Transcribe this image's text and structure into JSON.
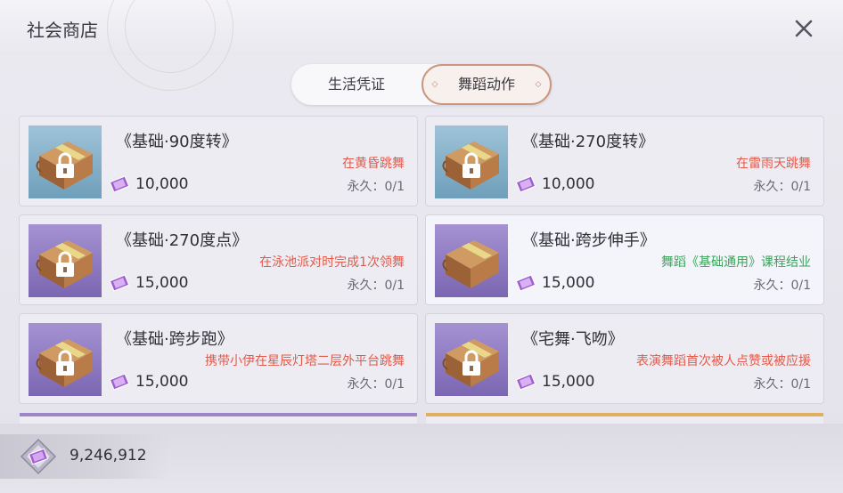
{
  "window": {
    "title": "社会商店"
  },
  "tabs": [
    {
      "label": "生活凭证",
      "selected": false
    },
    {
      "label": "舞蹈动作",
      "selected": true
    }
  ],
  "items": [
    {
      "name": "《基础·90度转》",
      "requirement": "在黄昏跳舞",
      "requirement_color": "red",
      "price": "10,000",
      "limit": "永久：0/1",
      "locked": true,
      "thumb_bg": "blue"
    },
    {
      "name": "《基础·270度转》",
      "requirement": "在雷雨天跳舞",
      "requirement_color": "red",
      "price": "10,000",
      "limit": "永久：0/1",
      "locked": true,
      "thumb_bg": "blue"
    },
    {
      "name": "《基础·270度点》",
      "requirement": "在泳池派对时完成1次领舞",
      "requirement_color": "red",
      "price": "15,000",
      "limit": "永久：0/1",
      "locked": true,
      "thumb_bg": "purple"
    },
    {
      "name": "《基础·跨步伸手》",
      "requirement": "舞蹈《基础通用》课程结业",
      "requirement_color": "green",
      "price": "15,000",
      "limit": "永久：0/1",
      "locked": false,
      "thumb_bg": "purple"
    },
    {
      "name": "《基础·跨步跑》",
      "requirement": "携带小伊在星辰灯塔二层外平台跳舞",
      "requirement_color": "red",
      "price": "15,000",
      "limit": "永久：0/1",
      "locked": true,
      "thumb_bg": "purple"
    },
    {
      "name": "《宅舞·飞吻》",
      "requirement": "表演舞蹈首次被人点赞或被应援",
      "requirement_color": "red",
      "price": "15,000",
      "limit": "永久：0/1",
      "locked": true,
      "thumb_bg": "purple"
    }
  ],
  "currency": {
    "amount": "9,246,912"
  },
  "colors": {
    "red": "#e25a4a",
    "green": "#3aa35a",
    "accent": "#c9967f"
  }
}
